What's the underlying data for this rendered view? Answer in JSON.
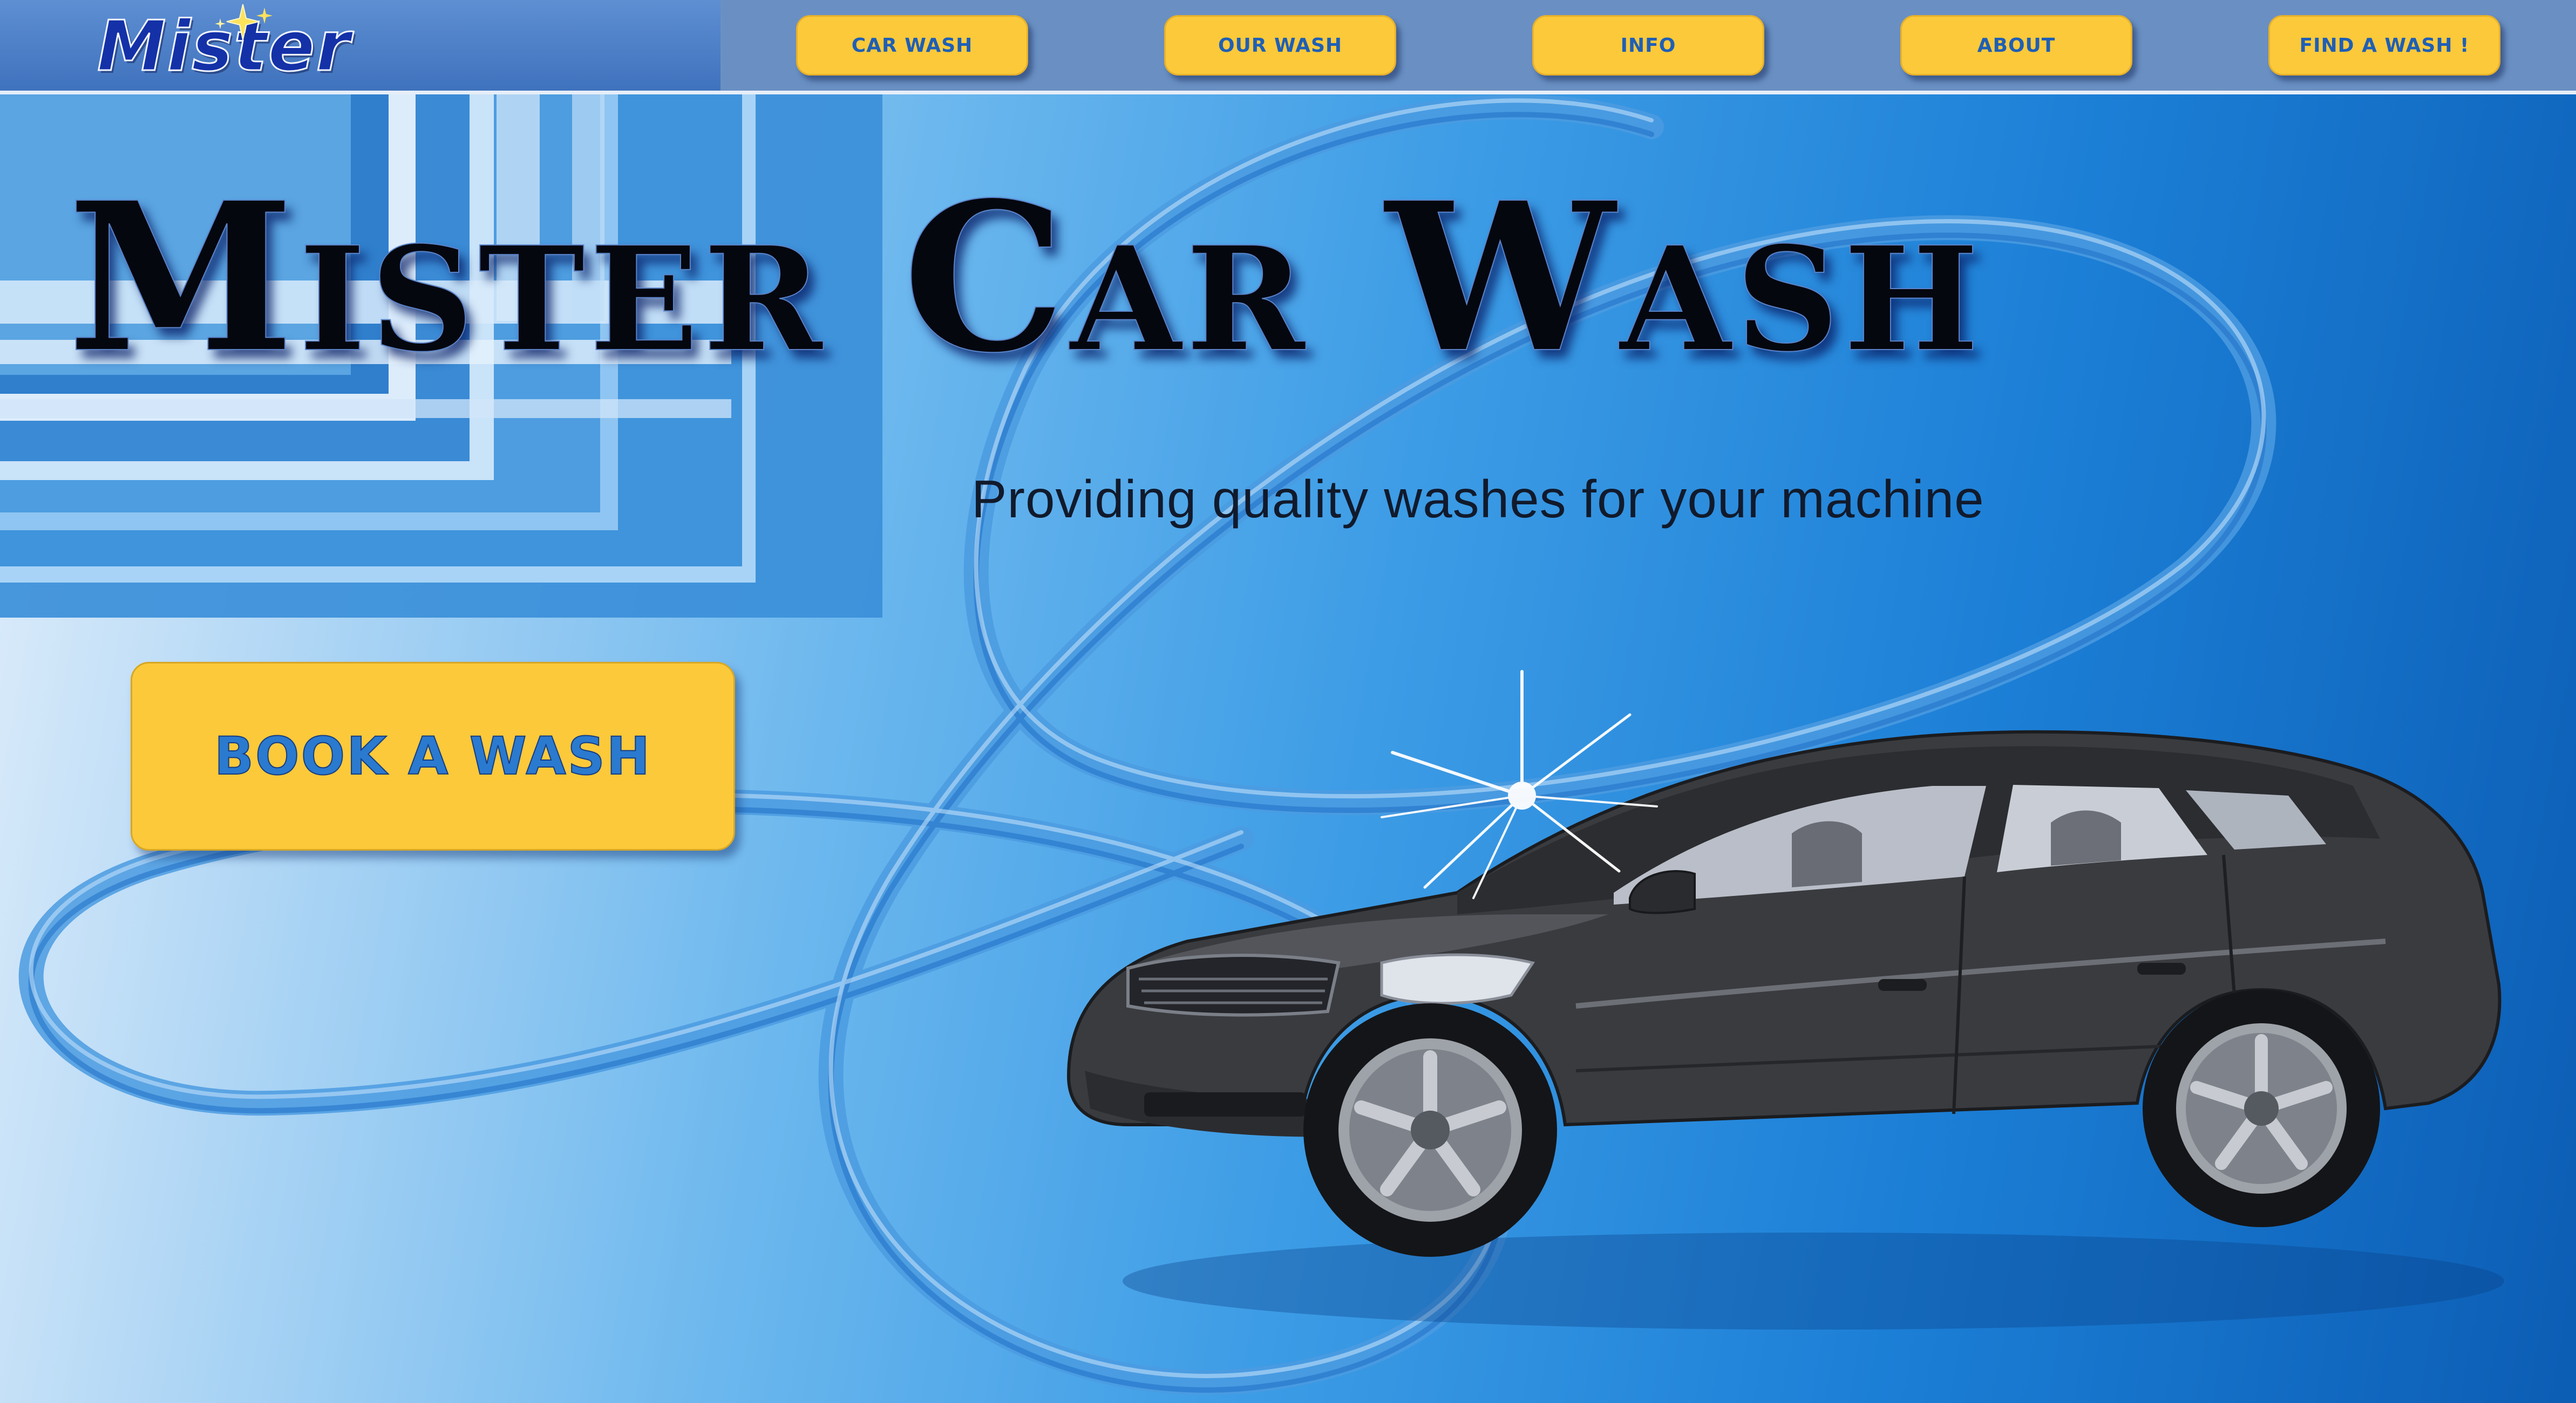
{
  "header": {
    "logo_text": "Mister",
    "nav": [
      {
        "label": "Car Wash"
      },
      {
        "label": "Our Wash"
      },
      {
        "label": "Info"
      },
      {
        "label": "About"
      },
      {
        "label": "Find A Wash !"
      }
    ]
  },
  "hero": {
    "title_word1": "Mister",
    "title_word2": "Car",
    "title_word3": "Wash",
    "subtitle": "Providing quality washes for your machine",
    "cta_label": "Book A Wash"
  },
  "colors": {
    "header_bar": "#6a90c3",
    "logo_panel": "#4a7ec8",
    "button_yellow": "#fbc93a",
    "button_text_blue": "#1f5fb6",
    "hero_light": "#e3effb",
    "hero_dark": "#0c5db4",
    "title_black": "#05070f",
    "car_body": "#3a3b3f"
  },
  "icons": {
    "logo_sparkle": "sparkle-icon",
    "car": "sedan-car-illustration",
    "headlight_shine": "shine-star-icon"
  }
}
